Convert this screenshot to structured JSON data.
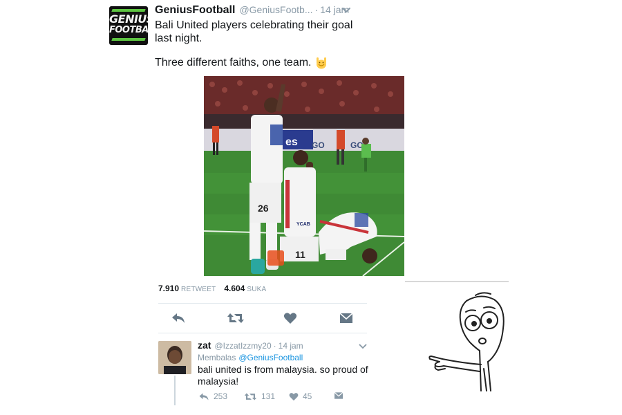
{
  "tweet": {
    "author_name": "GeniusFootball",
    "author_handle": "@GeniusFootb...",
    "separator": "·",
    "time": "14 jam",
    "text_line_1": "Bali United players celebrating their goal last night.",
    "text_line_2": "Three different faiths, one team.",
    "emoji": "raised-hands-icon",
    "avatar_logo_top": "GENIUS",
    "avatar_logo_bottom": "FOOTBALL",
    "photo": {
      "jersey_numbers": [
        "26",
        "11"
      ],
      "board_text": [
        "es",
        "GO",
        "GO"
      ],
      "sponsor_text": "YCAB"
    },
    "stats": {
      "retweets_count": "7.910",
      "retweets_label": "RETWEET",
      "likes_count": "4.604",
      "likes_label": "SUKA"
    },
    "actions": [
      "reply-icon",
      "retweet-icon",
      "heart-icon",
      "direct-message-icon"
    ]
  },
  "reply": {
    "author_name": "zat",
    "author_handle": "@IzzatIzzmy20",
    "separator": "·",
    "time": "14 jam",
    "replying_label": "Membalas",
    "replying_handle": "@GeniusFootball",
    "text": "bali united is from malaysia. so proud of malaysia!",
    "replies_count": "253",
    "retweets_count": "131",
    "likes_count": "45"
  },
  "colors": {
    "text": "#14171a",
    "muted": "#8899a6",
    "link": "#1b95e0",
    "icon": "#657786",
    "divider": "#e1e8ed",
    "logo_green": "#5ec542"
  },
  "meme": {
    "description_icon": "pointing-stick-figure-icon"
  }
}
